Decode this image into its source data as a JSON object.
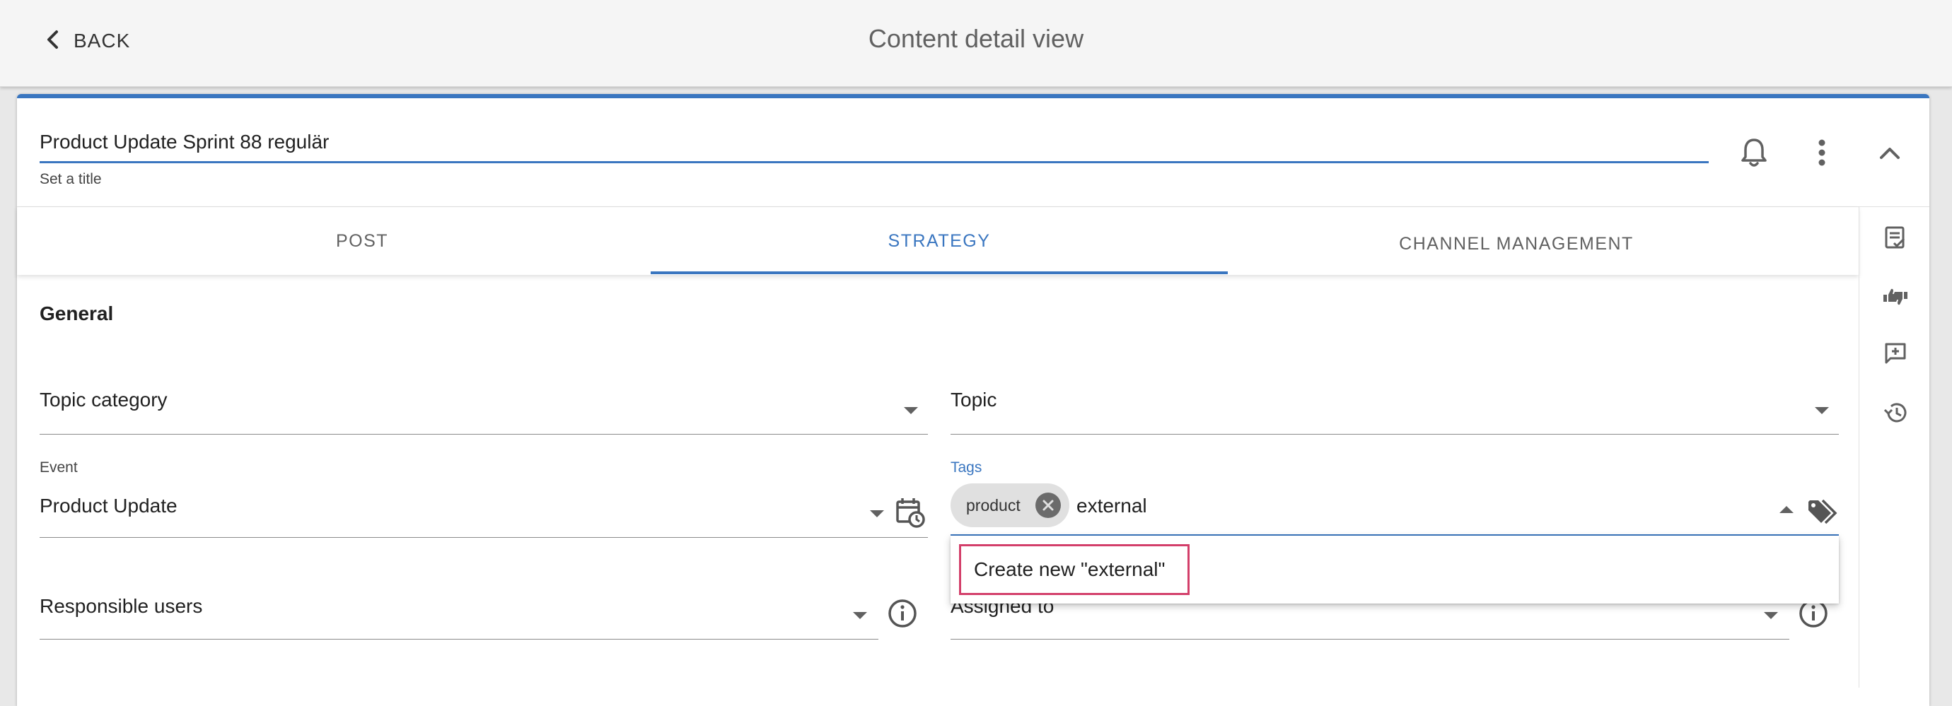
{
  "header": {
    "back_label": "BACK",
    "title": "Content detail view"
  },
  "content": {
    "title_value": "Product Update Sprint 88 regulär",
    "title_helper": "Set a title"
  },
  "tabs": [
    {
      "label": "POST",
      "active": false
    },
    {
      "label": "STRATEGY",
      "active": true
    },
    {
      "label": "CHANNEL MANAGEMENT",
      "active": false
    }
  ],
  "general": {
    "section_title": "General",
    "topic_category_label": "Topic category",
    "topic_label": "Topic",
    "event_label": "Event",
    "event_value": "Product Update",
    "tags_label": "Tags",
    "tags_chips": [
      "product"
    ],
    "tags_input_value": "external",
    "tags_dropdown_option": "Create new \"external\"",
    "responsible_users_label": "Responsible users",
    "assigned_to_label": "Assigned to"
  },
  "icons": {
    "back": "chevron-left-icon",
    "bell": "bell-icon",
    "more": "more-vert-icon",
    "collapse": "chevron-up-icon",
    "rail": [
      "checklist-icon",
      "thumbs-up-down-icon",
      "add-comment-icon",
      "history-icon"
    ]
  },
  "colors": {
    "accent": "#3a76c0",
    "highlight_border": "#d33f6a",
    "header_bg": "#f5f5f5"
  }
}
